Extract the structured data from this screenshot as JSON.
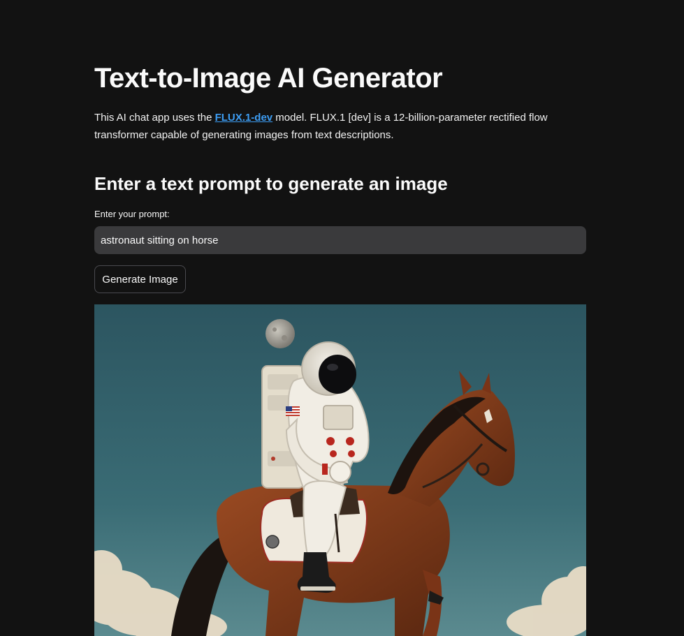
{
  "page": {
    "title": "Text-to-Image AI Generator",
    "intro_before_link": "This AI chat app uses the ",
    "intro_link": "FLUX.1-dev",
    "intro_after_link": " model. FLUX.1 [dev] is a 12-billion-parameter rectified flow transformer capable of generating images from text descriptions."
  },
  "form": {
    "heading": "Enter a text prompt to generate an image",
    "prompt_label": "Enter your prompt:",
    "prompt_value": "astronaut sitting on horse",
    "generate_label": "Generate Image"
  },
  "colors": {
    "background": "#121212",
    "input_background": "#3a3a3c",
    "link": "#3d9df3",
    "sky": "#2f5a63"
  }
}
